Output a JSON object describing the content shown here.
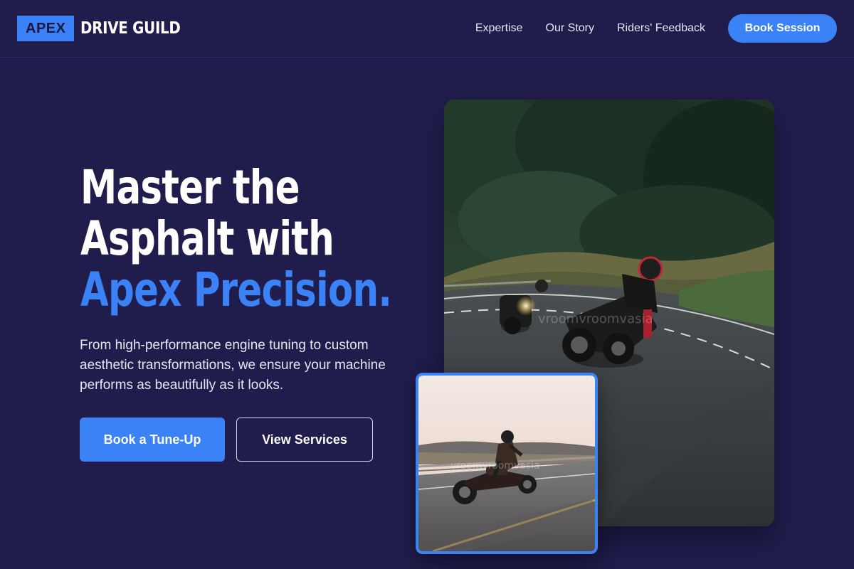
{
  "header": {
    "logo_box": "APEX",
    "logo_text": "DRIVE GUILD",
    "nav": [
      "Expertise",
      "Our Story",
      "Riders' Feedback"
    ],
    "cta": "Book Session"
  },
  "hero": {
    "headline_line1": "Master the",
    "headline_line2": "Asphalt with",
    "headline_accent": "Apex Precision.",
    "subtitle": "From high-performance engine tuning to custom aesthetic transformations, we ensure your machine performs as beautifully as it looks.",
    "primary_button": "Book a Tune-Up",
    "secondary_button": "View Services"
  },
  "images": {
    "main_alt": "Two motorcyclists leaning into a curve on a forest road",
    "small_alt": "Cruiser motorcycle riding along a highway at sunset",
    "watermark": "vroomvroomvasia"
  },
  "colors": {
    "background": "#201d4d",
    "accent": "#3b82f6",
    "text": "#ffffff"
  }
}
